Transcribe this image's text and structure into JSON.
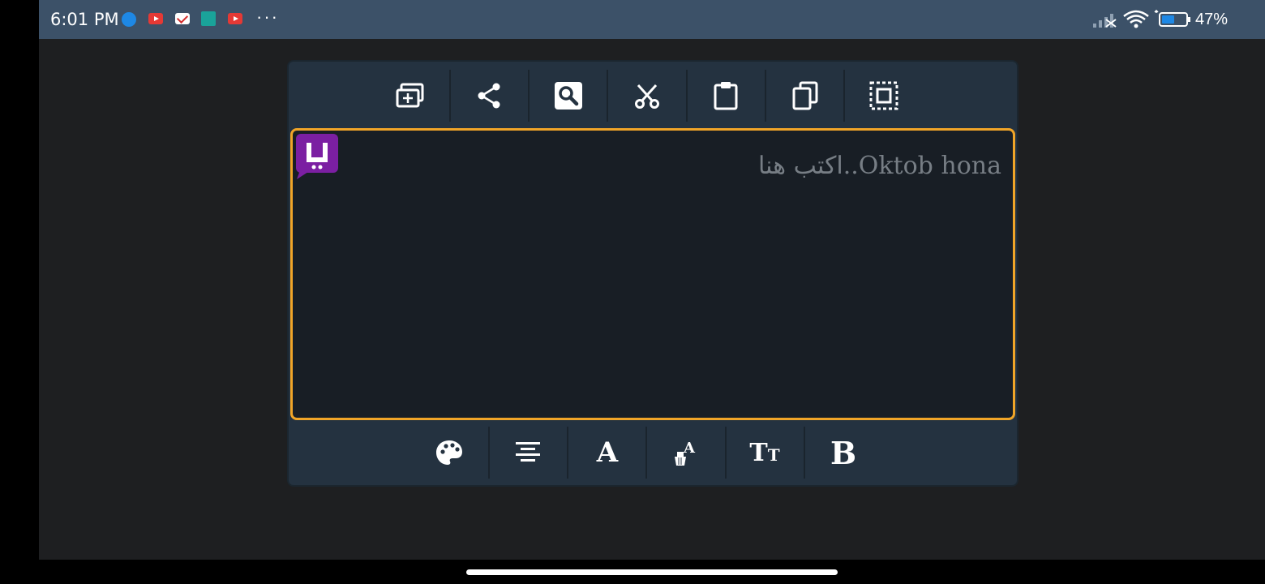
{
  "status_bar": {
    "time": "6:01 PM",
    "battery": "47%",
    "notification_icons": [
      "messenger-icon",
      "youtube-icon",
      "gmail-icon",
      "app-icon",
      "youtube-icon"
    ],
    "more": "···"
  },
  "toolbar_top": {
    "buttons": [
      {
        "icon": "new-window-icon"
      },
      {
        "icon": "share-icon"
      },
      {
        "icon": "search-icon"
      },
      {
        "icon": "cut-icon"
      },
      {
        "icon": "paste-icon"
      },
      {
        "icon": "copy-icon"
      },
      {
        "icon": "select-all-icon"
      }
    ]
  },
  "editor": {
    "placeholder": "اكتب هنا..Oktob hona",
    "border_color": "#f0a528"
  },
  "app_badge": {
    "letter": "ي",
    "color": "#7b1fa2"
  },
  "toolbar_bottom": {
    "buttons": [
      {
        "icon": "palette-icon"
      },
      {
        "icon": "align-center-icon"
      },
      {
        "icon": "font-icon",
        "glyph": "A"
      },
      {
        "icon": "text-color-icon",
        "glyph": "A"
      },
      {
        "icon": "text-size-icon",
        "glyph_big": "T",
        "glyph_small": "T"
      },
      {
        "icon": "bold-icon",
        "glyph": "B"
      }
    ]
  }
}
